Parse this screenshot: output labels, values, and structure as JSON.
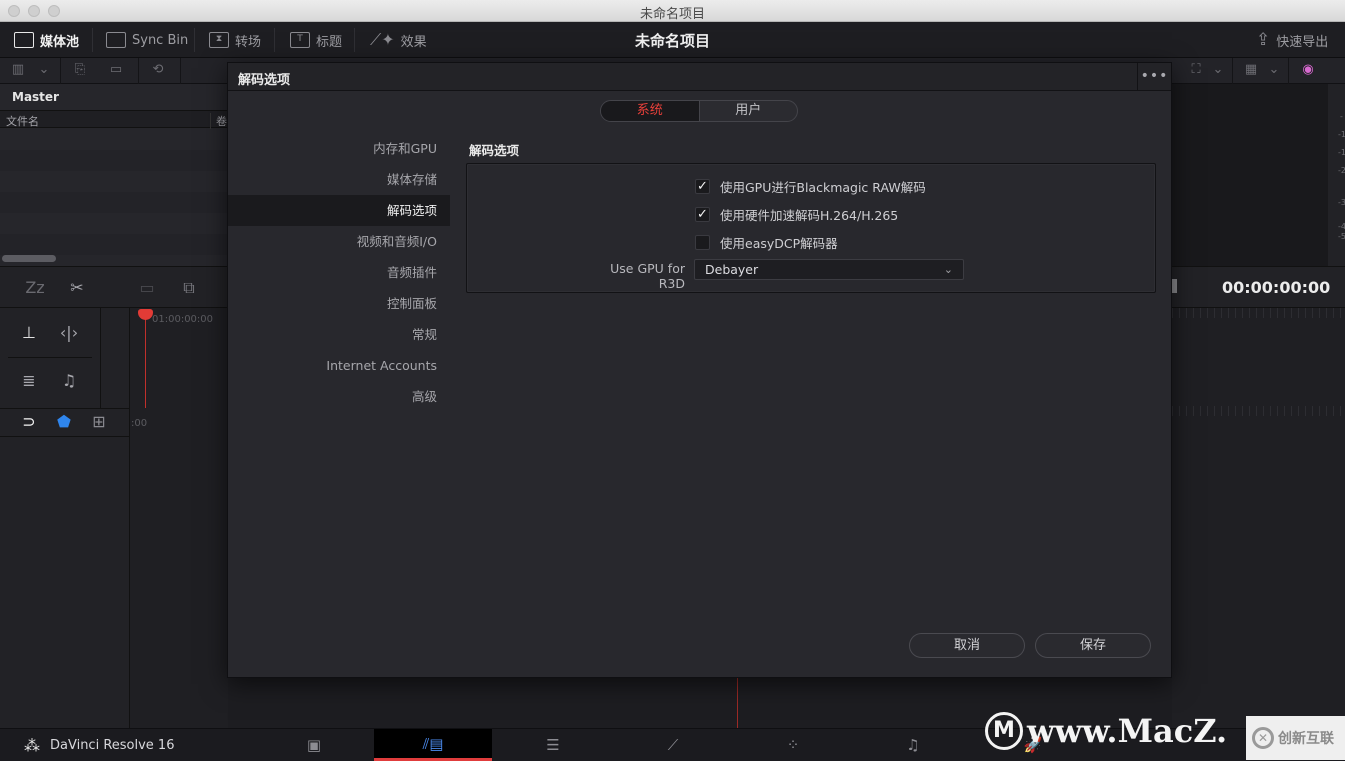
{
  "window": {
    "title": "未命名项目"
  },
  "toolbar": {
    "items": [
      {
        "label": "媒体池",
        "icon": "media-pool-icon",
        "active": true
      },
      {
        "label": "Sync Bin",
        "icon": "sync-bin-icon",
        "active": false
      },
      {
        "label": "转场",
        "icon": "transitions-icon",
        "active": false
      },
      {
        "label": "标题",
        "icon": "titles-icon",
        "active": false
      },
      {
        "label": "效果",
        "icon": "effects-wand-icon",
        "active": false
      }
    ],
    "project_title": "未命名项目",
    "quick_export": {
      "label": "快速导出",
      "icon": "export-icon"
    }
  },
  "media_pool": {
    "bin": "Master",
    "columns": [
      "文件名",
      "卷"
    ]
  },
  "timeline": {
    "ruler_start": "01:00:00:00",
    "ruler_partial": ":00",
    "timecode": "00:00:00:00"
  },
  "audio_meter": {
    "ticks": [
      "-",
      "-1",
      "-1",
      "-2",
      "-3",
      "-4",
      "-5"
    ]
  },
  "dialog": {
    "title": "解码选项",
    "more_label": "•••",
    "segments": [
      {
        "label": "系统",
        "active": true
      },
      {
        "label": "用户",
        "active": false
      }
    ],
    "nav": [
      {
        "label": "内存和GPU",
        "active": false
      },
      {
        "label": "媒体存储",
        "active": false
      },
      {
        "label": "解码选项",
        "active": true
      },
      {
        "label": "视频和音频I/O",
        "active": false
      },
      {
        "label": "音频插件",
        "active": false
      },
      {
        "label": "控制面板",
        "active": false
      },
      {
        "label": "常规",
        "active": false
      },
      {
        "label": "Internet Accounts",
        "active": false
      },
      {
        "label": "高级",
        "active": false
      }
    ],
    "section_title": "解码选项",
    "options": [
      {
        "label": "使用GPU进行Blackmagic RAW解码",
        "checked": true
      },
      {
        "label": "使用硬件加速解码H.264/H.265",
        "checked": true
      },
      {
        "label": "使用easyDCP解码器",
        "checked": false
      }
    ],
    "r3d": {
      "label": "Use GPU for R3D",
      "value": "Debayer"
    },
    "buttons": {
      "cancel": "取消",
      "save": "保存"
    }
  },
  "pagebar": {
    "brand": "DaVinci Resolve 16",
    "pages": [
      {
        "name": "media",
        "icon": "media-page-icon",
        "active": false
      },
      {
        "name": "cut",
        "icon": "cut-page-icon",
        "active": true
      },
      {
        "name": "edit",
        "icon": "edit-page-icon",
        "active": false
      },
      {
        "name": "fusion",
        "icon": "fusion-page-icon",
        "active": false
      },
      {
        "name": "color",
        "icon": "color-page-icon",
        "active": false
      },
      {
        "name": "fairlight",
        "icon": "fairlight-page-icon",
        "active": false
      },
      {
        "name": "deliver",
        "icon": "deliver-page-icon",
        "active": false
      }
    ],
    "accent_color": "#e03c3c"
  },
  "watermark": {
    "text": "www.MacZ.",
    "secondary": "创新互联"
  }
}
